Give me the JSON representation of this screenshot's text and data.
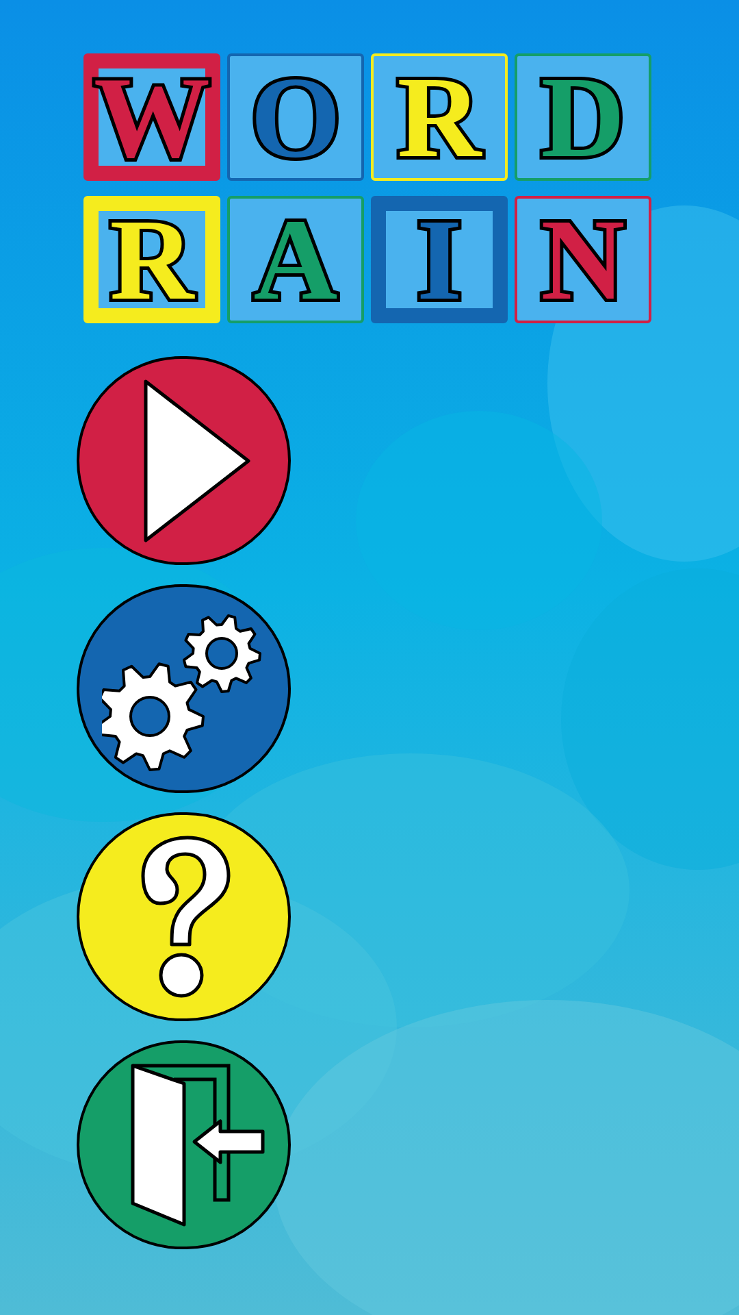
{
  "title_tiles": [
    {
      "letter": "W",
      "color": "#d12045",
      "framed": true
    },
    {
      "letter": "O",
      "color": "#1466b0",
      "framed": false
    },
    {
      "letter": "R",
      "color": "#f5ec1e",
      "framed": false
    },
    {
      "letter": "D",
      "color": "#159e68",
      "framed": false
    },
    {
      "letter": "R",
      "color": "#f5ec1e",
      "framed": true
    },
    {
      "letter": "A",
      "color": "#159e68",
      "framed": false
    },
    {
      "letter": "I",
      "color": "#1466b0",
      "framed": true
    },
    {
      "letter": "N",
      "color": "#d12045",
      "framed": false
    }
  ],
  "menu_buttons": [
    {
      "kind": "play",
      "color": "#d12045"
    },
    {
      "kind": "settings",
      "color": "#1466b0"
    },
    {
      "kind": "help",
      "color": "#f5ec1e"
    },
    {
      "kind": "exit",
      "color": "#159e68"
    }
  ]
}
